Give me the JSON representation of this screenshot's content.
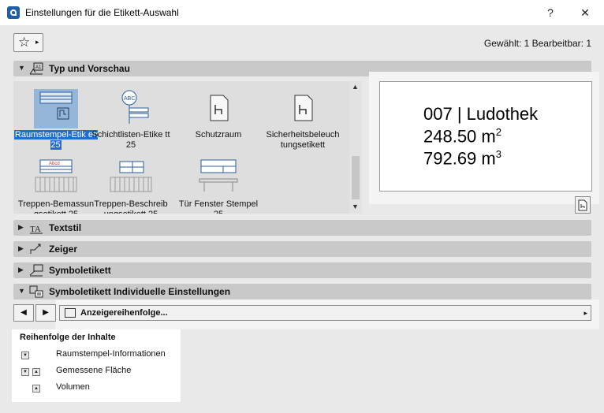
{
  "window": {
    "title": "Einstellungen für die Etikett-Auswahl",
    "help_btn": "?",
    "close_btn": "✕"
  },
  "toolbar": {
    "favorites_icon": "☆",
    "favorites_arrow": "▸",
    "selection_info": "Gewählt: 1 Bearbeitbar: 1"
  },
  "panels": {
    "type_preview": {
      "label": "Typ und Vorschau",
      "expanded": true
    },
    "text_style": {
      "label": "Textstil",
      "expanded": false
    },
    "pointer": {
      "label": "Zeiger",
      "expanded": false
    },
    "symbol_label": {
      "label": "Symboletikett",
      "expanded": false
    },
    "symbol_settings": {
      "label": "Symboletikett Individuelle Einstellungen",
      "expanded": true
    }
  },
  "gallery": {
    "items": [
      {
        "label": "Raumstempel-Etik ett 25",
        "selected": true
      },
      {
        "label": "Schichtlisten-Etike tt 25",
        "selected": false
      },
      {
        "label": "Schutzraum",
        "selected": false
      },
      {
        "label": "Sicherheitsbeleuch tungsetikett",
        "selected": false
      },
      {
        "label": "Treppen-Bemassun gsetikett 25",
        "selected": false
      },
      {
        "label": "Treppen-Beschreib ungsetikett 25",
        "selected": false
      },
      {
        "label": "Tür Fenster Stempel 25",
        "selected": false
      }
    ],
    "thumb_texts": {
      "abc": "ABC",
      "abcd": "Abcd"
    }
  },
  "preview": {
    "line1": "007 | Ludothek",
    "line2_value": "248.50 m",
    "line2_exp": "2",
    "line3_value": "792.69 m",
    "line3_exp": "3"
  },
  "settings": {
    "prev_btn": "◀",
    "next_btn": "▶",
    "dropdown_label": "Anzeigereihenfolge...",
    "dropdown_arrow": "▸"
  },
  "order": {
    "title": "Reihenfolge der Inhalte",
    "items": [
      {
        "label": "Raumstempel-Informationen",
        "down": true,
        "up": false
      },
      {
        "label": "Gemessene Fläche",
        "down": true,
        "up": true
      },
      {
        "label": "Volumen",
        "down": false,
        "up": true
      }
    ]
  },
  "colors": {
    "selection": "#1d6fd0",
    "panel_header": "#c9c9c9",
    "background": "#e9e9e9"
  }
}
